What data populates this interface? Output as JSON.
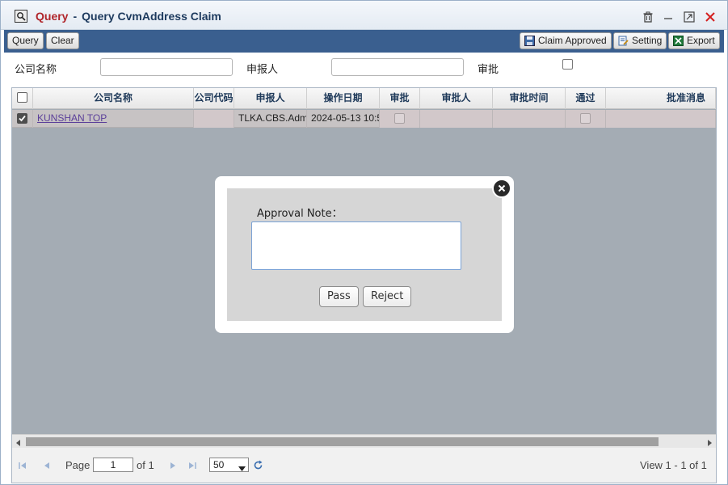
{
  "window": {
    "title_highlight": "Query",
    "title_separator": "-",
    "title_rest": "Query CvmAddress Claim"
  },
  "toolbar": {
    "query_label": "Query",
    "clear_label": "Clear",
    "claim_approved_label": "Claim Approved",
    "setting_label": "Setting",
    "export_label": "Export"
  },
  "search": {
    "company_label": "公司名称",
    "company_value": "",
    "applicant_label": "申报人",
    "applicant_value": "",
    "approval_label": "审批",
    "approval_checked": false
  },
  "grid": {
    "columns": [
      "公司名称",
      "公司代码",
      "申报人",
      "操作日期",
      "审批",
      "审批人",
      "审批时间",
      "通过",
      "批准消息"
    ],
    "rows": [
      {
        "selected": true,
        "company": "KUNSHAN TOP",
        "company_code": "",
        "applicant": "TLKA.CBS.Admin",
        "date": "2024-05-13 10:5",
        "approved": false,
        "approver": "",
        "approval_time": "",
        "passed": false,
        "message": ""
      }
    ]
  },
  "pager": {
    "page_label": "Page",
    "page_value": "1",
    "of_label": "of 1",
    "page_size": "50",
    "view_text": "View 1 - 1 of 1"
  },
  "dialog": {
    "note_label": "Approval Note：",
    "note_value": "",
    "pass_label": "Pass",
    "reject_label": "Reject"
  },
  "colors": {
    "toolbar_bg": "#3a5f8f",
    "title_accent": "#b0252a",
    "title_text": "#1d3a5e",
    "link": "#5b3f9a",
    "overlay": "#a4acb4"
  }
}
